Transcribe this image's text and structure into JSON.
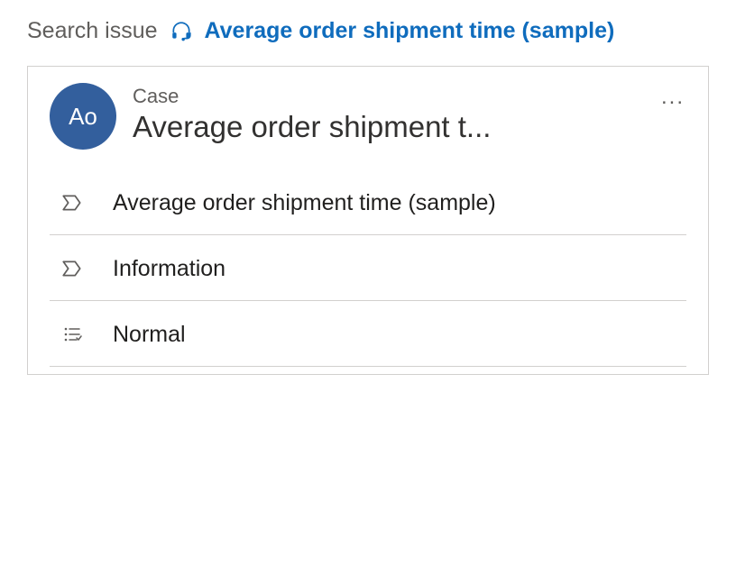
{
  "breadcrumb": {
    "root": "Search issue",
    "current": "Average order shipment time (sample)"
  },
  "card": {
    "avatar_initials": "Ao",
    "entity_type": "Case",
    "title": "Average order shipment t...",
    "more_label": "..."
  },
  "details": {
    "title": "Average order shipment time (sample)",
    "form": "Information",
    "priority": "Normal"
  }
}
